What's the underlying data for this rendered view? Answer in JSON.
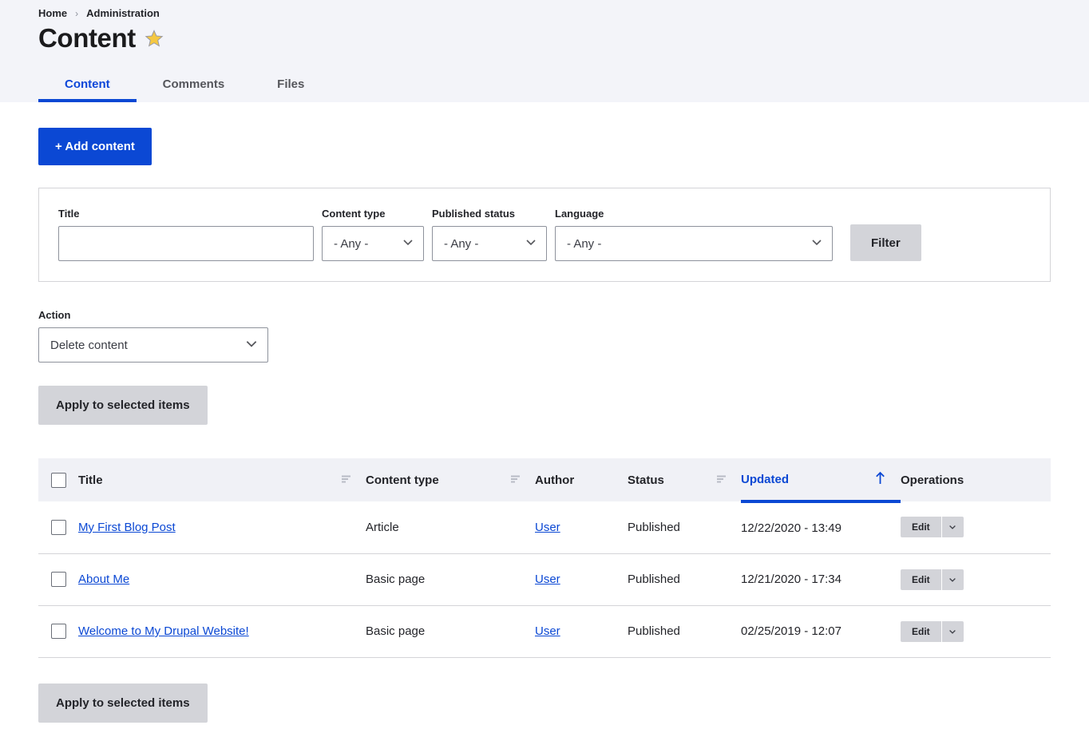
{
  "breadcrumb": {
    "items": [
      "Home",
      "Administration"
    ],
    "separator": "›"
  },
  "page": {
    "title": "Content",
    "star_icon": "star-icon"
  },
  "tabs": [
    {
      "label": "Content",
      "active": true
    },
    {
      "label": "Comments",
      "active": false
    },
    {
      "label": "Files",
      "active": false
    }
  ],
  "toolbar": {
    "add_content_label": "+ Add content"
  },
  "filters": {
    "title": {
      "label": "Title",
      "value": "",
      "placeholder": ""
    },
    "content_type": {
      "label": "Content type",
      "value": "- Any -"
    },
    "published_status": {
      "label": "Published status",
      "value": "- Any -"
    },
    "language": {
      "label": "Language",
      "value": "- Any -"
    },
    "filter_button": "Filter"
  },
  "action": {
    "label": "Action",
    "value": "Delete content",
    "apply_label": "Apply to selected items",
    "apply_label_bottom": "Apply to selected items"
  },
  "table": {
    "columns": [
      {
        "key": "select",
        "label": "",
        "sortable": false
      },
      {
        "key": "title",
        "label": "Title",
        "sortable": true
      },
      {
        "key": "content_type",
        "label": "Content type",
        "sortable": true
      },
      {
        "key": "author",
        "label": "Author",
        "sortable": false
      },
      {
        "key": "status",
        "label": "Status",
        "sortable": true
      },
      {
        "key": "updated",
        "label": "Updated",
        "sortable": true,
        "sorted": "asc"
      },
      {
        "key": "operations",
        "label": "Operations",
        "sortable": false
      }
    ],
    "rows": [
      {
        "title": "My First Blog Post",
        "content_type": "Article",
        "author": "User",
        "status": "Published",
        "updated": "12/22/2020 - 13:49",
        "operation": "Edit"
      },
      {
        "title": "About Me",
        "content_type": "Basic page",
        "author": "User",
        "status": "Published",
        "updated": "12/21/2020 - 17:34",
        "operation": "Edit"
      },
      {
        "title": "Welcome to My Drupal Website!",
        "content_type": "Basic page",
        "author": "User",
        "status": "Published",
        "updated": "02/25/2019 - 12:07",
        "operation": "Edit"
      }
    ]
  },
  "colors": {
    "primary": "#0b48d4",
    "header_band": "#f3f4f9",
    "button_gray": "#d3d4d9",
    "star": "#f4c430"
  }
}
